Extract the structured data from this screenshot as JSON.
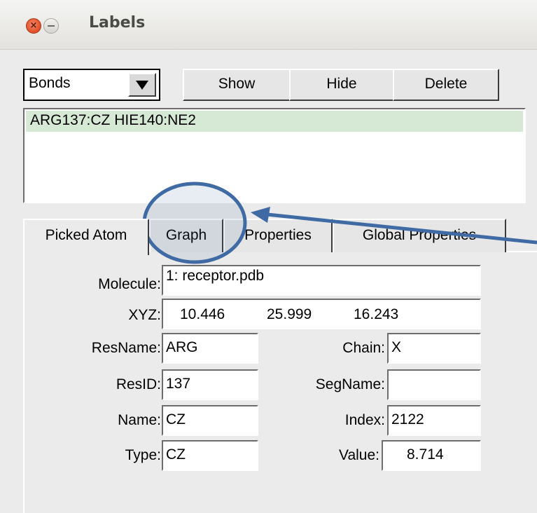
{
  "window": {
    "title": "Labels"
  },
  "icons": {
    "close": "close-icon",
    "minimize": "minimize-icon",
    "dropdown": "chevron-down-icon"
  },
  "toolbar": {
    "type_select": {
      "value": "Bonds"
    },
    "show_label": "Show",
    "hide_label": "Hide",
    "delete_label": "Delete"
  },
  "label_list": {
    "items": [
      "ARG137:CZ  HIE140:NE2"
    ]
  },
  "tabs": [
    {
      "label": "Picked Atom",
      "active": true
    },
    {
      "label": "Graph",
      "active": false
    },
    {
      "label": "Properties",
      "active": false
    },
    {
      "label": "Global Properties",
      "active": false
    }
  ],
  "picked_atom": {
    "molecule": {
      "label": "Molecule:",
      "value": "1: receptor.pdb"
    },
    "xyz": {
      "label": "XYZ:",
      "x": "10.446",
      "y": "25.999",
      "z": "16.243"
    },
    "resname": {
      "label": "ResName:",
      "value": "ARG"
    },
    "chain": {
      "label": "Chain:",
      "value": "X"
    },
    "resid": {
      "label": "ResID:",
      "value": "137"
    },
    "segname": {
      "label": "SegName:",
      "value": ""
    },
    "name": {
      "label": "Name:",
      "value": "CZ"
    },
    "index": {
      "label": "Index:",
      "value": "2122"
    },
    "type": {
      "label": "Type:",
      "value": "CZ"
    },
    "value": {
      "label": "Value:",
      "value": "8.714"
    }
  },
  "colors": {
    "annotation": "#3f6aa3",
    "selection": "#d6e9d4",
    "close_button": "#e0522b"
  }
}
